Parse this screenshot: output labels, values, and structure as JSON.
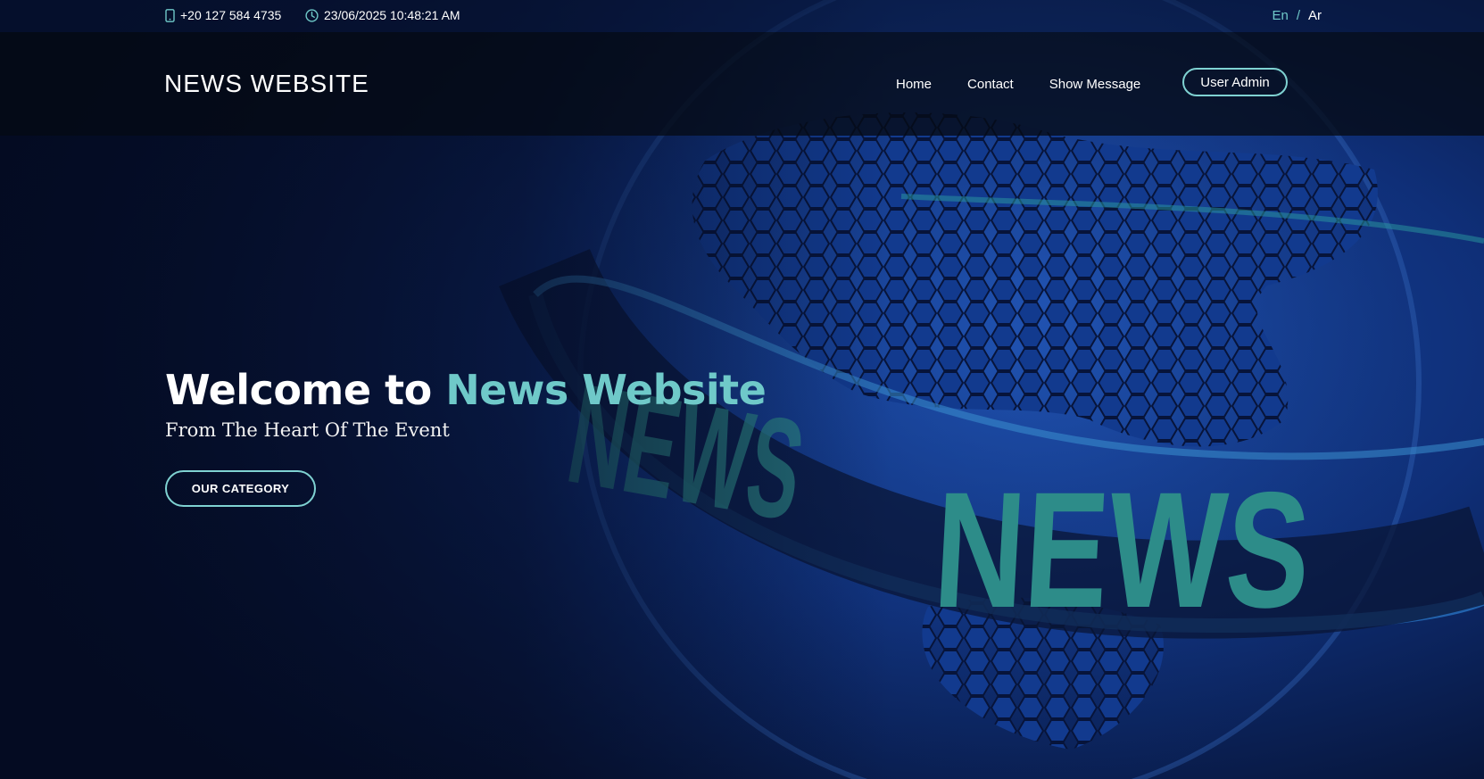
{
  "topbar": {
    "phone_icon": "mobile-phone-icon",
    "phone": "+20 127 584 4735",
    "clock_icon": "clock-icon",
    "datetime": "23/06/2025 10:48:21 AM",
    "lang_en": "En",
    "lang_separator": "/",
    "lang_ar": "Ar"
  },
  "navbar": {
    "brand": "NEWS WEBSITE",
    "links": [
      "Home",
      "Contact",
      "Show Message"
    ],
    "admin_button": "User Admin"
  },
  "hero": {
    "title_prefix": "Welcome to",
    "title_highlight": "News Website",
    "subtitle": "From The Heart Of The Event",
    "cta": "OUR CATEGORY",
    "background_text": "NEWS"
  },
  "colors": {
    "accent": "#6fc9c9",
    "background": "#061230",
    "navbar": "#050a14"
  }
}
